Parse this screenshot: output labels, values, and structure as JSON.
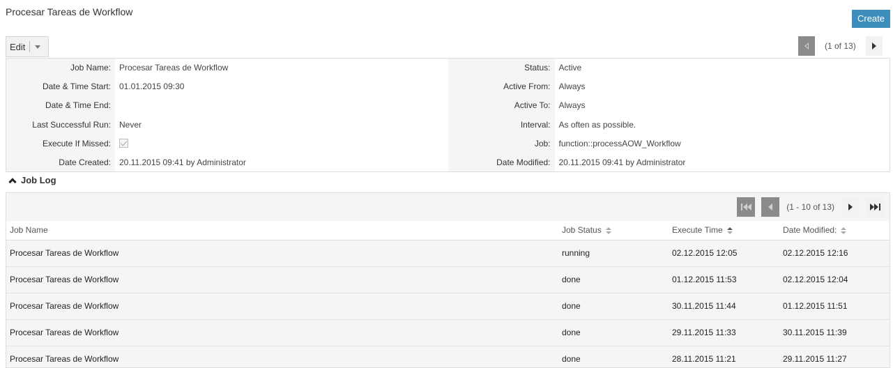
{
  "page": {
    "title": "Procesar Tareas de Workflow",
    "create_label": "Create"
  },
  "actions": {
    "edit_label": "Edit"
  },
  "detail_pager": {
    "count": "(1 of 13)"
  },
  "detail": {
    "left": [
      {
        "label": "Job Name:",
        "value": "Procesar Tareas de Workflow"
      },
      {
        "label": "Date & Time Start:",
        "value": "01.01.2015 09:30"
      },
      {
        "label": "Date & Time End:",
        "value": ""
      },
      {
        "label": "Last Successful Run:",
        "value": "Never"
      },
      {
        "label": "Execute If Missed:",
        "value": ""
      },
      {
        "label": "Date Created:",
        "value": "20.11.2015 09:41 by Administrator"
      }
    ],
    "right": [
      {
        "label": "Status:",
        "value": "Active"
      },
      {
        "label": "Active From:",
        "value": "Always"
      },
      {
        "label": "Active To:",
        "value": "Always"
      },
      {
        "label": "Interval:",
        "value": "As often as possible."
      },
      {
        "label": "Job:",
        "value": "function::processAOW_Workflow"
      },
      {
        "label": "Date Modified:",
        "value": "20.11.2015 09:41 by Administrator"
      }
    ],
    "execute_if_missed_checked": true
  },
  "job_log": {
    "title": "Job Log",
    "pager_count": "(1 - 10 of 13)",
    "columns": [
      "Job Name",
      "Job Status",
      "Execute Time",
      "Date Modified:"
    ],
    "rows": [
      [
        "Procesar Tareas de Workflow",
        "running",
        "02.12.2015 12:05",
        "02.12.2015 12:16"
      ],
      [
        "Procesar Tareas de Workflow",
        "done",
        "01.12.2015 11:53",
        "02.12.2015 12:04"
      ],
      [
        "Procesar Tareas de Workflow",
        "done",
        "30.11.2015 11:44",
        "01.12.2015 11:51"
      ],
      [
        "Procesar Tareas de Workflow",
        "done",
        "29.11.2015 11:33",
        "30.11.2015 11:39"
      ],
      [
        "Procesar Tareas de Workflow",
        "done",
        "28.11.2015 11:21",
        "29.11.2015 11:27"
      ]
    ]
  },
  "colors": {
    "accent": "#3c8dbc",
    "disabled_button": "#8a8a8a",
    "panel_bg": "#f5f5f5"
  }
}
